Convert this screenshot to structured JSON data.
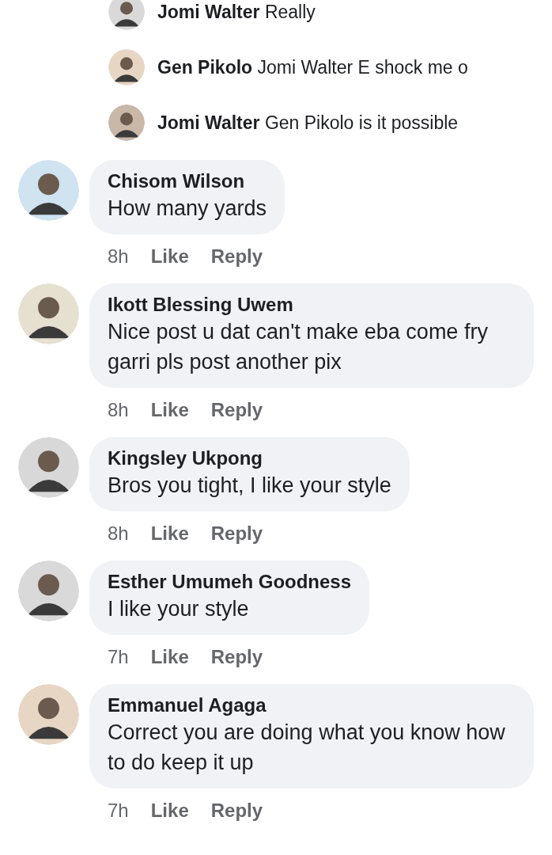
{
  "replies": [
    {
      "author": "Jomi Walter",
      "text": "Really"
    },
    {
      "author": "Gen Pikolo",
      "text": "Jomi Walter E shock me o"
    },
    {
      "author": "Jomi Walter",
      "text": "Gen Pikolo is it possible"
    }
  ],
  "comments": [
    {
      "author": "Chisom Wilson",
      "text": "How many yards",
      "time": "8h",
      "like": "Like",
      "reply": "Reply"
    },
    {
      "author": "Ikott Blessing Uwem",
      "text": "Nice post u dat can't make eba come fry garri pls post another pix",
      "time": "8h",
      "like": "Like",
      "reply": "Reply"
    },
    {
      "author": "Kingsley Ukpong",
      "text": "Bros you tight, I like your style",
      "time": "8h",
      "like": "Like",
      "reply": "Reply"
    },
    {
      "author": "Esther Umumeh Goodness",
      "text": "I like your style",
      "time": "7h",
      "like": "Like",
      "reply": "Reply"
    },
    {
      "author": "Emmanuel Agaga",
      "text": "Correct you are doing what you know how to do keep it up",
      "time": "7h",
      "like": "Like",
      "reply": "Reply"
    }
  ]
}
